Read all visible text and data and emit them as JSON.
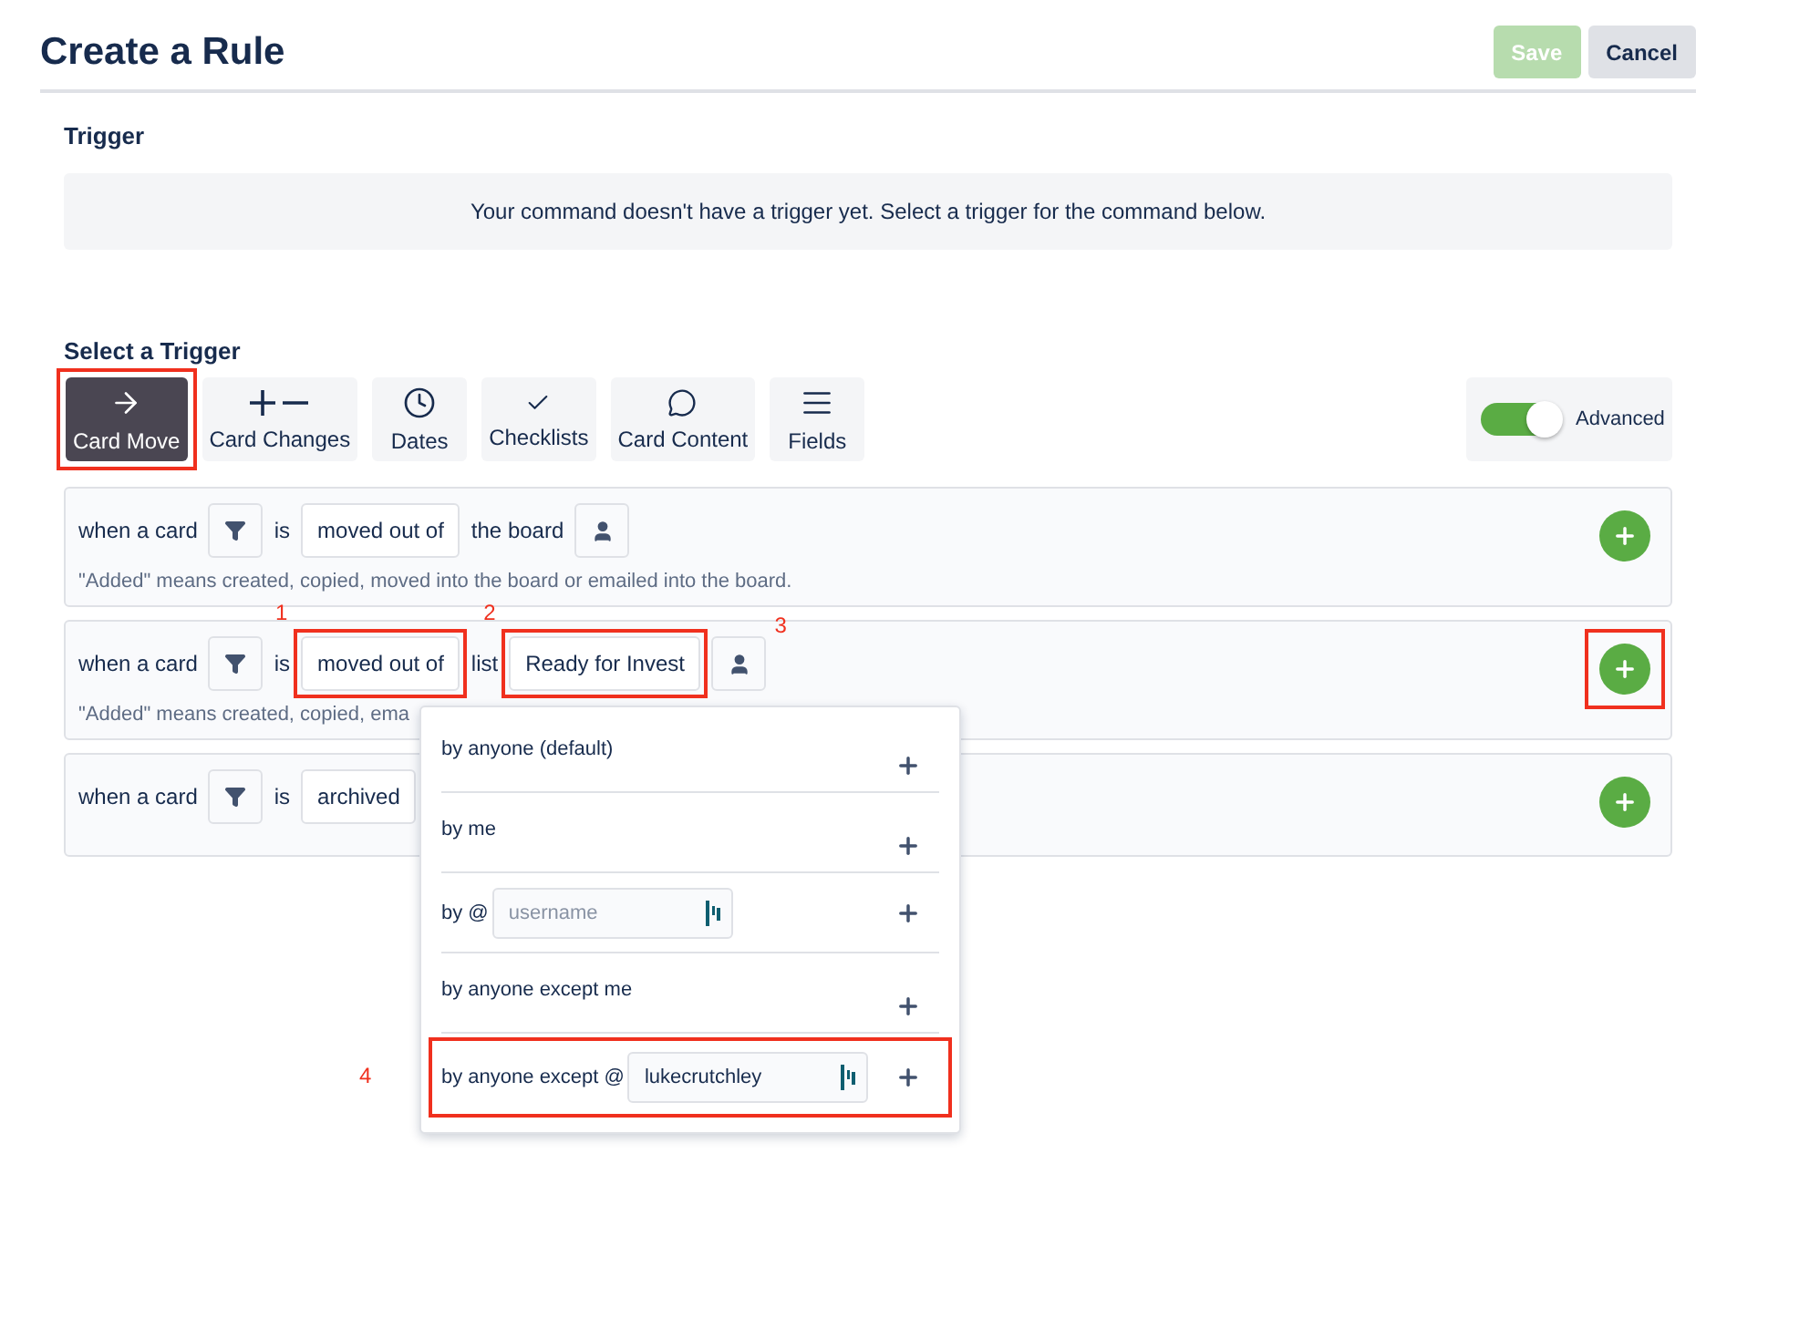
{
  "header": {
    "title": "Create a Rule",
    "buttons": [
      {
        "label": "Save",
        "kind": "primary",
        "disabled": true
      },
      {
        "label": "Cancel",
        "kind": "secondary",
        "disabled": false
      }
    ]
  },
  "trigger": {
    "heading": "Trigger",
    "notice": "Your command doesn't have a trigger yet. Select a trigger for the command below."
  },
  "select_trigger": {
    "heading": "Select a Trigger",
    "tabs": [
      {
        "label": "Card Move",
        "kind": "arrow",
        "selected": true,
        "highlighted": true
      },
      {
        "label": "Card Changes",
        "kind": "plus-minus",
        "selected": false,
        "highlighted": false
      },
      {
        "label": "Dates",
        "kind": "clock",
        "selected": false,
        "highlighted": false
      },
      {
        "label": "Checklists",
        "kind": "check",
        "selected": false,
        "highlighted": false
      },
      {
        "label": "Card Content",
        "kind": "comment",
        "selected": false,
        "highlighted": false
      },
      {
        "label": "Fields",
        "kind": "lines",
        "selected": false,
        "highlighted": false
      }
    ],
    "advanced": {
      "label": "Advanced",
      "on": true
    }
  },
  "rules": [
    {
      "parts": [
        {
          "kind": "text",
          "text": "when a card"
        },
        {
          "kind": "filter"
        },
        {
          "kind": "text",
          "text": "is"
        },
        {
          "kind": "select",
          "value": "moved out of",
          "highlighted": false
        },
        {
          "kind": "text",
          "text": "the board"
        },
        {
          "kind": "person"
        }
      ],
      "hint": "\"Added\" means created, copied, moved into the board or emailed into the board.",
      "add_highlighted": false,
      "popover": false
    },
    {
      "parts": [
        {
          "kind": "text",
          "text": "when a card"
        },
        {
          "kind": "filter"
        },
        {
          "kind": "text",
          "text": "is"
        },
        {
          "kind": "select",
          "value": "moved out of",
          "highlighted": true,
          "note": "1"
        },
        {
          "kind": "text",
          "text": "list"
        },
        {
          "kind": "select",
          "value": "Ready for Invest",
          "highlighted": true,
          "note": "2"
        },
        {
          "kind": "person",
          "note": "3"
        }
      ],
      "hint": "\"Added\" means created, copied, ema",
      "add_highlighted": true,
      "popover": true
    },
    {
      "parts": [
        {
          "kind": "text",
          "text": "when a card"
        },
        {
          "kind": "filter"
        },
        {
          "kind": "text",
          "text": "is"
        },
        {
          "kind": "select",
          "value": "archived",
          "highlighted": false
        }
      ],
      "add_highlighted": false,
      "popover": false
    }
  ],
  "popover": {
    "items": [
      {
        "kind": "plain",
        "label": "by anyone (default)",
        "highlighted": false
      },
      {
        "kind": "plain",
        "label": "by me",
        "highlighted": false
      },
      {
        "kind": "input",
        "label": "by @",
        "placeholder": "username",
        "highlighted": false
      },
      {
        "kind": "plain",
        "label": "by anyone except me",
        "highlighted": false
      },
      {
        "kind": "input",
        "label": "by anyone except @",
        "value": "lukecrutchley",
        "highlighted": true,
        "note": "4"
      }
    ]
  }
}
